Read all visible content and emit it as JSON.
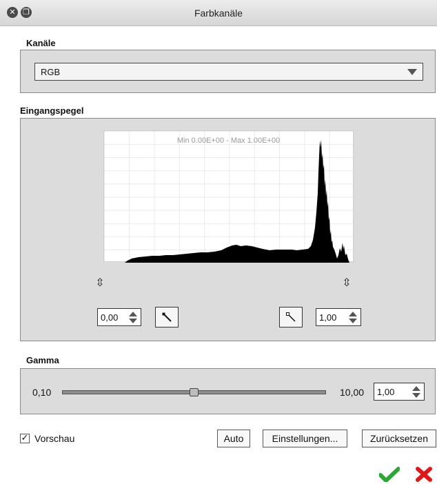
{
  "window": {
    "title": "Farbkanäle"
  },
  "channels": {
    "label": "Kanäle",
    "selected": "RGB"
  },
  "input_levels": {
    "label": "Eingangspegel",
    "histogram_caption": "Min 0.00E+00 - Max 1.00E+00",
    "low_value": "0,00",
    "high_value": "1,00"
  },
  "gamma": {
    "label": "Gamma",
    "min_label": "0,10",
    "max_label": "10,00",
    "value": "1,00",
    "slider_fraction": 0.5
  },
  "footer": {
    "preview_label": "Vorschau",
    "preview_checked": true,
    "auto_label": "Auto",
    "settings_label": "Einstellungen...",
    "reset_label": "Zurücksetzen"
  },
  "icons": {
    "close": "close-icon",
    "restore": "restore-icon",
    "dropdown": "chevron-down-icon",
    "eyedropper_black": "eyedropper-icon",
    "eyedropper_white": "eyedropper-icon",
    "level_handle": "vertical-arrows-icon",
    "ok": "checkmark-icon",
    "cancel": "cross-icon",
    "ok_color": "#2aa832",
    "cancel_color": "#e01818"
  }
}
